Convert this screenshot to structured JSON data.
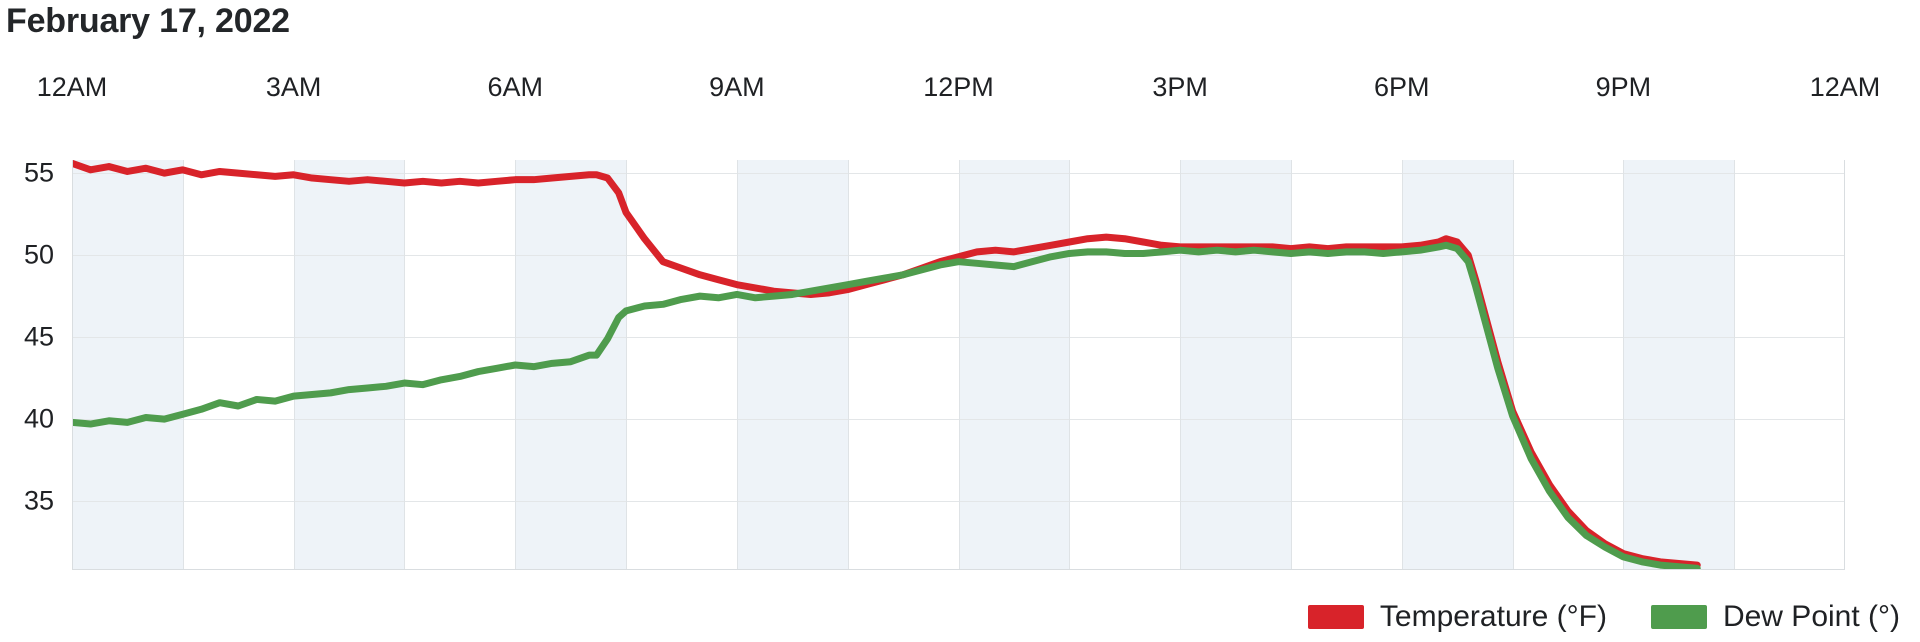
{
  "title": "February 17, 2022",
  "legend": {
    "items": [
      {
        "label": "Temperature (°F)",
        "color": "#d8232a"
      },
      {
        "label": "Dew Point (°)",
        "color": "#4f9c4d"
      }
    ]
  },
  "chart_data": {
    "type": "line",
    "title": "February 17, 2022",
    "xlabel": "",
    "ylabel": "",
    "grid": true,
    "legend_position": "bottom-right",
    "x_axis_position": "top",
    "xlim": [
      0,
      24
    ],
    "ylim": [
      30.8,
      55.8
    ],
    "yticks": [
      55,
      50,
      45,
      40,
      35
    ],
    "ytick_labels": [
      "55",
      "50",
      "45",
      "40",
      "35"
    ],
    "xticks": [
      0,
      3,
      6,
      9,
      12,
      15,
      18,
      21,
      24
    ],
    "xtick_labels": [
      "12AM",
      "3AM",
      "6AM",
      "9AM",
      "12PM",
      "3PM",
      "6PM",
      "9PM",
      "12AM"
    ],
    "x_unit": "hours",
    "band_shading_hours": 1.5,
    "band_color": "#eef3f8",
    "data_ends_at_hour": 22.0,
    "series": [
      {
        "name": "Temperature (°F)",
        "color": "#d8232a",
        "x": [
          0.0,
          0.25,
          0.5,
          0.75,
          1.0,
          1.25,
          1.5,
          1.75,
          2.0,
          2.25,
          2.5,
          2.75,
          3.0,
          3.25,
          3.5,
          3.75,
          4.0,
          4.25,
          4.5,
          4.75,
          5.0,
          5.25,
          5.5,
          5.75,
          6.0,
          6.25,
          6.5,
          6.75,
          7.0,
          7.1,
          7.25,
          7.4,
          7.5,
          7.75,
          8.0,
          8.25,
          8.5,
          8.75,
          9.0,
          9.25,
          9.5,
          9.75,
          10.0,
          10.25,
          10.5,
          10.75,
          11.0,
          11.25,
          11.5,
          11.75,
          12.0,
          12.25,
          12.5,
          12.75,
          13.0,
          13.25,
          13.5,
          13.75,
          14.0,
          14.25,
          14.5,
          14.75,
          15.0,
          15.25,
          15.5,
          15.75,
          16.0,
          16.25,
          16.5,
          16.75,
          17.0,
          17.25,
          17.5,
          17.75,
          18.0,
          18.25,
          18.5,
          18.6,
          18.75,
          18.9,
          19.0,
          19.15,
          19.3,
          19.5,
          19.75,
          20.0,
          20.25,
          20.5,
          20.75,
          21.0,
          21.25,
          21.5,
          21.75,
          22.0
        ],
        "y": [
          55.6,
          55.2,
          55.4,
          55.1,
          55.3,
          55.0,
          55.2,
          54.9,
          55.1,
          55.0,
          54.9,
          54.8,
          54.9,
          54.7,
          54.6,
          54.5,
          54.6,
          54.5,
          54.4,
          54.5,
          54.4,
          54.5,
          54.4,
          54.5,
          54.6,
          54.6,
          54.7,
          54.8,
          54.9,
          54.9,
          54.7,
          53.8,
          52.6,
          51.0,
          49.6,
          49.2,
          48.8,
          48.5,
          48.2,
          48.0,
          47.8,
          47.7,
          47.6,
          47.7,
          47.9,
          48.2,
          48.5,
          48.8,
          49.2,
          49.6,
          49.9,
          50.2,
          50.3,
          50.2,
          50.4,
          50.6,
          50.8,
          51.0,
          51.1,
          51.0,
          50.8,
          50.6,
          50.5,
          50.5,
          50.5,
          50.5,
          50.5,
          50.5,
          50.4,
          50.5,
          50.4,
          50.5,
          50.5,
          50.5,
          50.5,
          50.6,
          50.8,
          51.0,
          50.8,
          50.0,
          48.5,
          46.0,
          43.5,
          40.5,
          38.0,
          36.0,
          34.4,
          33.2,
          32.4,
          31.8,
          31.5,
          31.3,
          31.2,
          31.1
        ]
      },
      {
        "name": "Dew Point (°)",
        "color": "#4f9c4d",
        "x": [
          0.0,
          0.25,
          0.5,
          0.75,
          1.0,
          1.25,
          1.5,
          1.75,
          2.0,
          2.25,
          2.5,
          2.75,
          3.0,
          3.25,
          3.5,
          3.75,
          4.0,
          4.25,
          4.5,
          4.75,
          5.0,
          5.25,
          5.5,
          5.75,
          6.0,
          6.25,
          6.5,
          6.75,
          7.0,
          7.1,
          7.25,
          7.4,
          7.5,
          7.75,
          8.0,
          8.25,
          8.5,
          8.75,
          9.0,
          9.25,
          9.5,
          9.75,
          10.0,
          10.25,
          10.5,
          10.75,
          11.0,
          11.25,
          11.5,
          11.75,
          12.0,
          12.25,
          12.5,
          12.75,
          13.0,
          13.25,
          13.5,
          13.75,
          14.0,
          14.25,
          14.5,
          14.75,
          15.0,
          15.25,
          15.5,
          15.75,
          16.0,
          16.25,
          16.5,
          16.75,
          17.0,
          17.25,
          17.5,
          17.75,
          18.0,
          18.25,
          18.5,
          18.6,
          18.75,
          18.9,
          19.0,
          19.15,
          19.3,
          19.5,
          19.75,
          20.0,
          20.25,
          20.5,
          20.75,
          21.0,
          21.25,
          21.5,
          21.75,
          22.0
        ],
        "y": [
          39.8,
          39.7,
          39.9,
          39.8,
          40.1,
          40.0,
          40.3,
          40.6,
          41.0,
          40.8,
          41.2,
          41.1,
          41.4,
          41.5,
          41.6,
          41.8,
          41.9,
          42.0,
          42.2,
          42.1,
          42.4,
          42.6,
          42.9,
          43.1,
          43.3,
          43.2,
          43.4,
          43.5,
          43.9,
          43.9,
          44.9,
          46.2,
          46.6,
          46.9,
          47.0,
          47.3,
          47.5,
          47.4,
          47.6,
          47.4,
          47.5,
          47.6,
          47.8,
          48.0,
          48.2,
          48.4,
          48.6,
          48.8,
          49.1,
          49.4,
          49.6,
          49.5,
          49.4,
          49.3,
          49.6,
          49.9,
          50.1,
          50.2,
          50.2,
          50.1,
          50.1,
          50.2,
          50.3,
          50.2,
          50.3,
          50.2,
          50.3,
          50.2,
          50.1,
          50.2,
          50.1,
          50.2,
          50.2,
          50.1,
          50.2,
          50.3,
          50.5,
          50.6,
          50.4,
          49.6,
          48.1,
          45.6,
          43.1,
          40.2,
          37.6,
          35.6,
          34.0,
          32.9,
          32.2,
          31.6,
          31.3,
          31.1,
          31.0,
          30.9
        ]
      }
    ]
  }
}
